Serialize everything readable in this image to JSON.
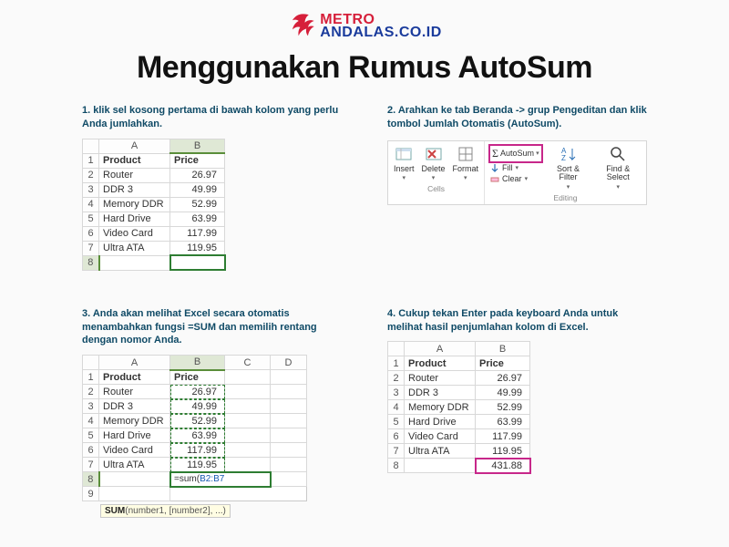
{
  "logo": {
    "line1": "METRO",
    "line2": "ANDALAS.CO.ID"
  },
  "title": "Menggunakan Rumus AutoSum",
  "steps": {
    "s1": {
      "caption": "1. klik sel kosong pertama di bawah kolom yang perlu Anda jumlahkan."
    },
    "s2": {
      "caption": "2. Arahkan ke tab Beranda -> grup Pengeditan dan klik tombol Jumlah Otomatis (AutoSum)."
    },
    "s3": {
      "caption": "3. Anda akan melihat Excel secara otomatis menambahkan fungsi =SUM dan memilih rentang dengan nomor Anda."
    },
    "s4": {
      "caption": "4. Cukup tekan Enter pada keyboard Anda untuk melihat hasil penjumlahan kolom di Excel."
    }
  },
  "cols": {
    "A": "A",
    "B": "B",
    "C": "C",
    "D": "D"
  },
  "hdr": {
    "product": "Product",
    "price": "Price"
  },
  "rows": [
    {
      "n": "1"
    },
    {
      "n": "2",
      "p": "Router",
      "v": "26.97"
    },
    {
      "n": "3",
      "p": "DDR 3",
      "v": "49.99"
    },
    {
      "n": "4",
      "p": "Memory DDR",
      "v": "52.99"
    },
    {
      "n": "5",
      "p": "Hard Drive",
      "v": "63.99"
    },
    {
      "n": "6",
      "p": "Video Card",
      "v": "117.99"
    },
    {
      "n": "7",
      "p": "Ultra ATA",
      "v": "119.95"
    },
    {
      "n": "8"
    }
  ],
  "formula": {
    "text_pre": "=sum(",
    "range": "B2:B7",
    "text_post": ""
  },
  "tooltip": {
    "bold": "SUM",
    "rest": "(number1, [number2], ...)"
  },
  "result": "431.88",
  "ribbon": {
    "insert": "Insert",
    "delete": "Delete",
    "format": "Format",
    "cells": "Cells",
    "autosum": "AutoSum",
    "fill": "Fill",
    "clear": "Clear",
    "sort": "Sort & Filter",
    "find": "Find & Select",
    "editing": "Editing"
  },
  "rownum9": "9"
}
